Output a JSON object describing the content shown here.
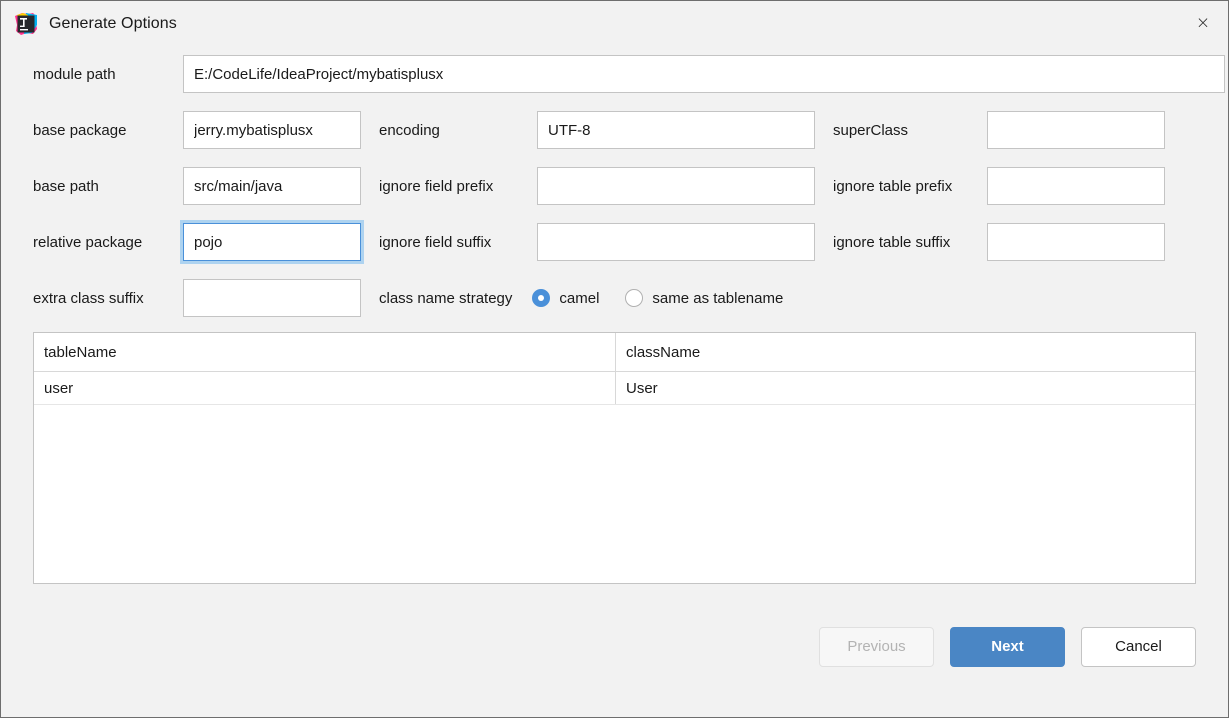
{
  "window": {
    "title": "Generate Options",
    "icon": "intellij-idea-icon",
    "close_label": "×"
  },
  "form": {
    "rows": [
      {
        "label": "module path",
        "value": "E:/CodeLife/IdeaProject/mybatisplusx",
        "placeholder": ""
      },
      {
        "label": "base package",
        "value": "jerry.mybatisplusx",
        "label2": "encoding",
        "value2": "UTF-8",
        "label3": "superClass",
        "value3": ""
      },
      {
        "label": "base path",
        "value": "src/main/java",
        "label2": "ignore field prefix",
        "value2": "",
        "label3": "ignore table prefix",
        "value3": ""
      },
      {
        "label": "relative package",
        "value": "pojo",
        "label2": "ignore field suffix",
        "value2": "",
        "label3": "ignore table suffix",
        "value3": ""
      },
      {
        "label": "extra class suffix",
        "value": ""
      }
    ],
    "strategy": {
      "label": "class name strategy",
      "options": [
        {
          "label": "camel",
          "selected": true
        },
        {
          "label": "same as tablename",
          "selected": false
        }
      ]
    }
  },
  "table": {
    "columns": [
      "tableName",
      "className"
    ],
    "rows": [
      {
        "tableName": "user",
        "className": "User"
      }
    ]
  },
  "footer": {
    "previous_label": "Previous",
    "next_label": "Next",
    "cancel_label": "Cancel"
  },
  "colors": {
    "accent": "#4a90d9",
    "primary_button": "#4a86c5",
    "focus_ring": "#aed3f0",
    "background": "#f2f2f2"
  }
}
